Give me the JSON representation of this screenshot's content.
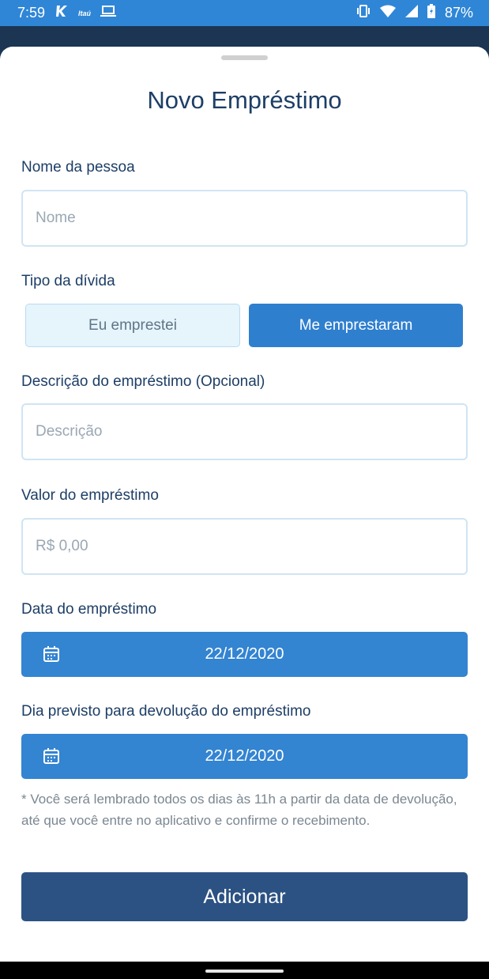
{
  "status_bar": {
    "time": "7:59",
    "battery": "87%",
    "icons": [
      "k-app-icon",
      "itau-icon",
      "laptop-icon",
      "vibrate-icon",
      "wifi-icon",
      "signal-icon",
      "battery-icon"
    ],
    "itau_text": "Itaú"
  },
  "title": "Novo Empréstimo",
  "form": {
    "name": {
      "label": "Nome da pessoa",
      "placeholder": "Nome",
      "value": ""
    },
    "debt_type": {
      "label": "Tipo da dívida",
      "options": [
        "Eu emprestei",
        "Me emprestaram"
      ],
      "selected": "Me emprestaram"
    },
    "description": {
      "label": "Descrição do empréstimo (Opcional)",
      "placeholder": "Descrição",
      "value": ""
    },
    "amount": {
      "label": "Valor do empréstimo",
      "placeholder": "R$ 0,00",
      "value": ""
    },
    "loan_date": {
      "label": "Data do empréstimo",
      "value": "22/12/2020"
    },
    "return_date": {
      "label": "Dia previsto para devolução do empréstimo",
      "value": "22/12/2020"
    },
    "note": "* Você será lembrado todos os dias às 11h a partir da data de devolução, até que você entre no aplicativo e confirme o recebimento.",
    "submit_label": "Adicionar"
  },
  "colors": {
    "status_bar": "#2f86d6",
    "primary": "#3384d1",
    "submit": "#2c5283",
    "title_text": "#1d3e66"
  }
}
